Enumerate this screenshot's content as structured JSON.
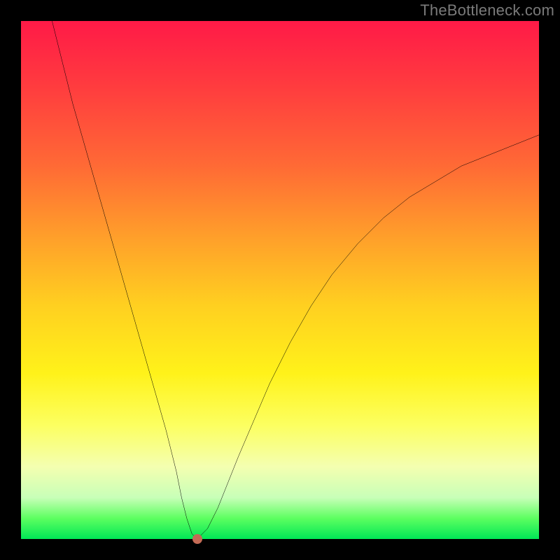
{
  "watermark": "TheBottleneck.com",
  "chart_data": {
    "type": "line",
    "title": "",
    "xlabel": "",
    "ylabel": "",
    "xlim": [
      0,
      100
    ],
    "ylim": [
      0,
      100
    ],
    "grid": false,
    "legend": false,
    "background_gradient": [
      "#ff1a47",
      "#ff6a35",
      "#ffd020",
      "#fcff60",
      "#00e756"
    ],
    "series": [
      {
        "name": "bottleneck-curve",
        "color": "#000000",
        "x": [
          6,
          8,
          10,
          12,
          14,
          16,
          18,
          20,
          22,
          24,
          26,
          28,
          30,
          31,
          32,
          33,
          34,
          35,
          36,
          38,
          40,
          42,
          45,
          48,
          52,
          56,
          60,
          65,
          70,
          75,
          80,
          85,
          90,
          95,
          100
        ],
        "y": [
          100,
          92,
          84,
          77,
          70,
          63,
          56,
          49,
          42,
          35,
          28,
          21,
          13,
          8,
          4,
          1,
          0,
          1,
          2,
          6,
          11,
          16,
          23,
          30,
          38,
          45,
          51,
          57,
          62,
          66,
          69,
          72,
          74,
          76,
          78
        ]
      }
    ],
    "marker": {
      "x": 34,
      "y": 0,
      "color": "#c46a55"
    }
  }
}
